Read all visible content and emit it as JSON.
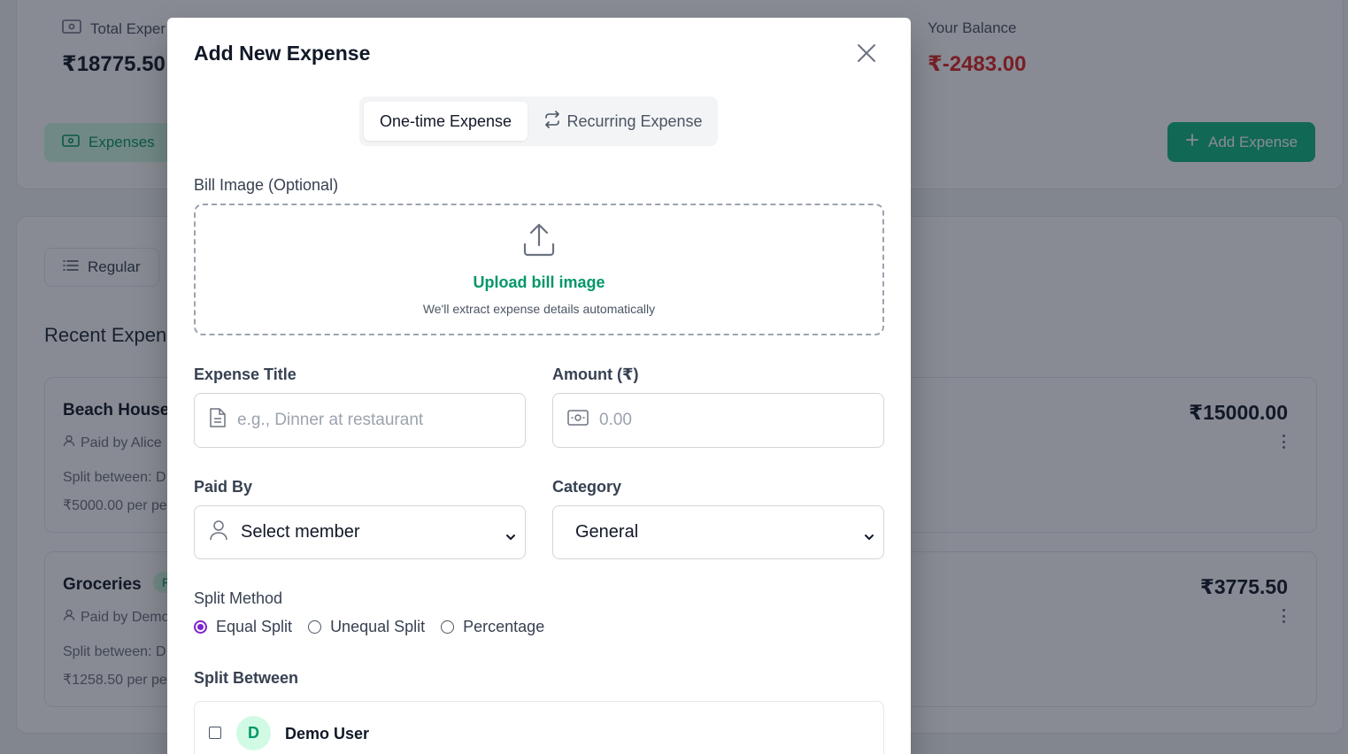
{
  "background": {
    "stats": [
      {
        "label": "Total Expenses",
        "visible_label": "Total Exper",
        "value": "₹18775.50"
      },
      {
        "label": "Your Balance",
        "value": "₹-2483.00"
      }
    ],
    "tabs": {
      "expenses": "Expenses",
      "regular": "Regular"
    },
    "add_expense_label": "Add Expense",
    "section_title": "Recent Expens",
    "expenses": [
      {
        "title": "Beach House",
        "paid_by": "Paid by Alice",
        "split": "Split between: D",
        "per_person": "₹5000.00 per pe",
        "amount": "₹15000.00"
      },
      {
        "title": "Groceries",
        "badge": "F",
        "paid_by": "Paid by Demo",
        "split": "Split between: D",
        "per_person": "₹1258.50 per pe",
        "amount": "₹3775.50"
      }
    ],
    "colors": {
      "accent": "#10b981",
      "negative": "#dc2626"
    }
  },
  "modal": {
    "title": "Add New Expense",
    "tabs": [
      {
        "label": "One-time Expense",
        "active": true
      },
      {
        "label": "Recurring Expense",
        "active": false,
        "icon": "repeat-icon"
      }
    ],
    "bill_image": {
      "label": "Bill Image (Optional)",
      "upload_title": "Upload bill image",
      "upload_subtitle": "We'll extract expense details automatically",
      "icon": "upload-icon"
    },
    "expense_title": {
      "label": "Expense Title",
      "placeholder": "e.g., Dinner at restaurant",
      "icon": "document-icon"
    },
    "amount": {
      "label": "Amount (₹)",
      "placeholder": "0.00",
      "icon": "cash-icon"
    },
    "paid_by": {
      "label": "Paid By",
      "value": "Select member",
      "icon": "user-icon"
    },
    "category": {
      "label": "Category",
      "value": "General"
    },
    "split_method": {
      "label": "Split Method",
      "options": [
        {
          "label": "Equal Split",
          "checked": true
        },
        {
          "label": "Unequal Split",
          "checked": false
        },
        {
          "label": "Percentage",
          "checked": false
        }
      ]
    },
    "split_between": {
      "label": "Split Between",
      "members": [
        {
          "initial": "D",
          "name": "Demo User",
          "checked": false
        }
      ]
    },
    "colors": {
      "accent": "#059669",
      "radio": "#7e22ce"
    }
  }
}
